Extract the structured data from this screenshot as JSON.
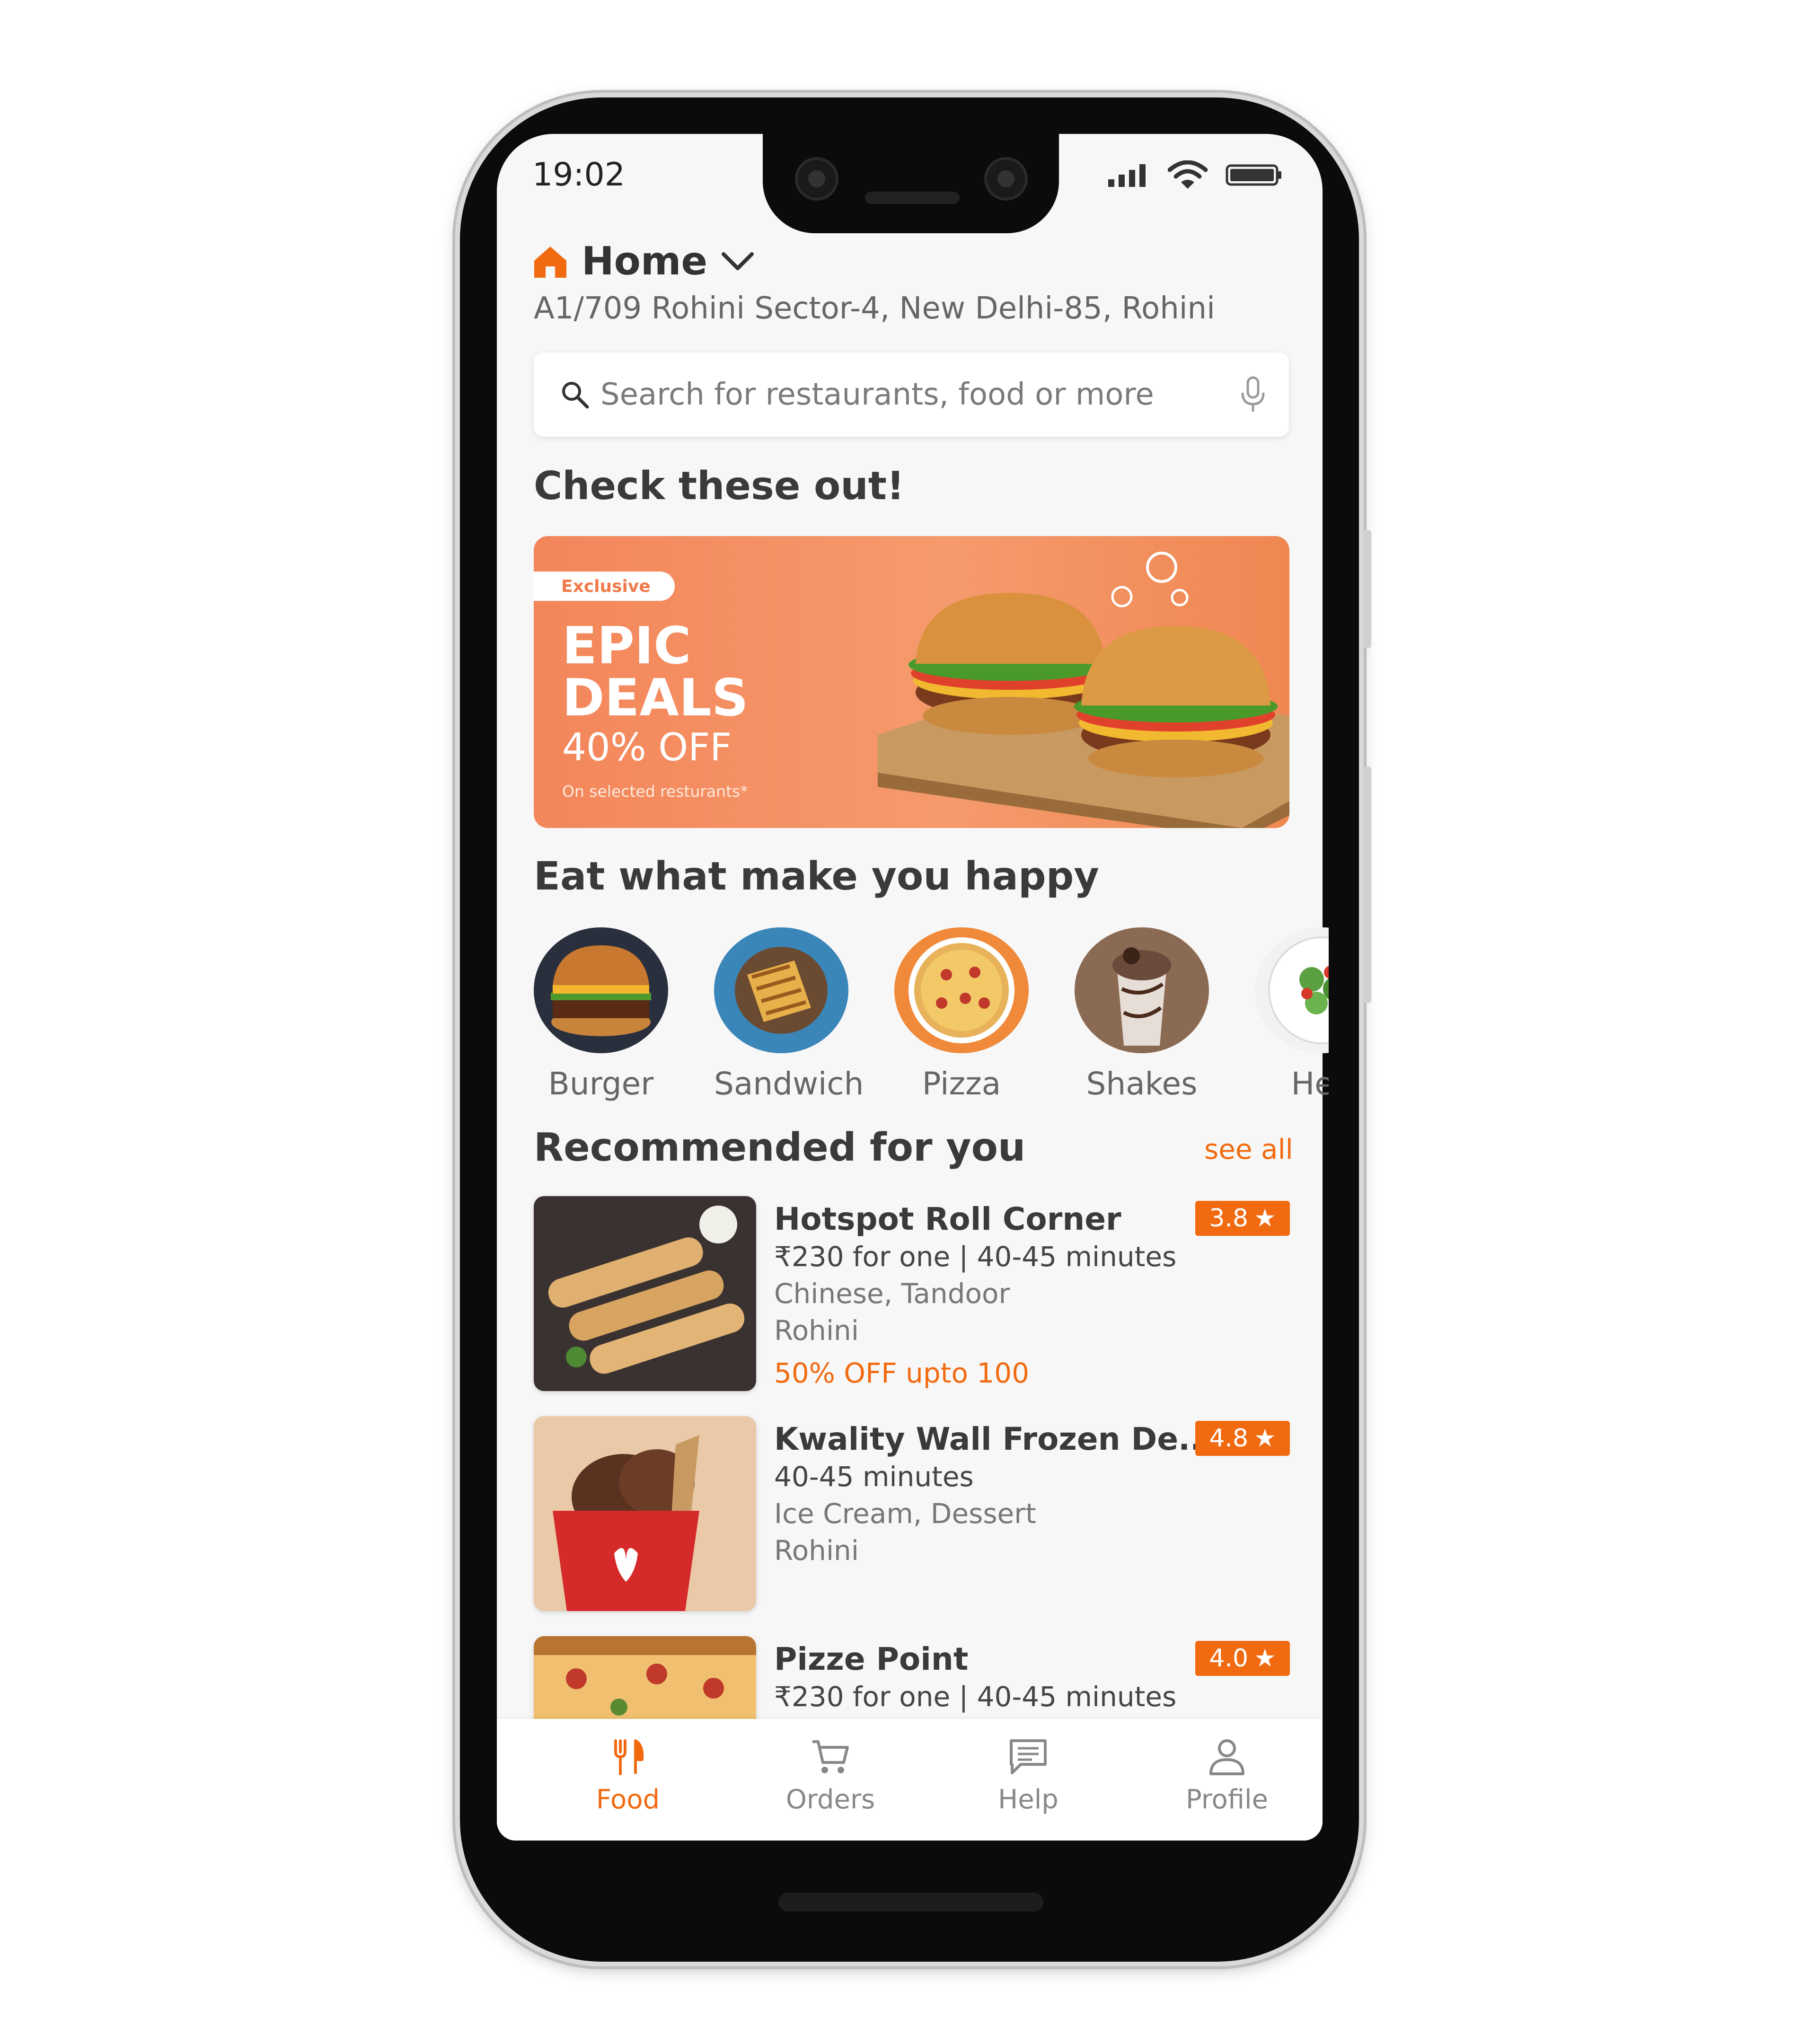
{
  "status": {
    "time": "19:02"
  },
  "location": {
    "label": "Home",
    "address": "A1/709 Rohini Sector-4, New Delhi-85, Rohini"
  },
  "search": {
    "placeholder": "Search for restaurants, food or more"
  },
  "promo": {
    "title": "Check these out!",
    "badge": "Exclusive",
    "headline": "EPIC DEALS",
    "offer": "40% OFF",
    "note": "On selected resturants*"
  },
  "categories": {
    "title": "Eat what make you happy",
    "items": [
      {
        "label": "Burger"
      },
      {
        "label": "Sandwich"
      },
      {
        "label": "Pizza"
      },
      {
        "label": "Shakes"
      },
      {
        "label": "Hea"
      }
    ]
  },
  "recommended": {
    "title": "Recommended for you",
    "see_all": "see all",
    "items": [
      {
        "name": "Hotspot Roll Corner",
        "rating": "3.8",
        "price_time": "₹230 for one | 40-45 minutes",
        "cuisine": "Chinese, Tandoor",
        "area": "Rohini",
        "offer": "50% OFF upto 100"
      },
      {
        "name": "Kwality Wall Frozen De..",
        "rating": "4.8",
        "price_time": "40-45 minutes",
        "cuisine": "Ice Cream, Dessert",
        "area": "Rohini"
      },
      {
        "name": "Pizze Point",
        "rating": "4.0",
        "price_time": "₹230 for one | 40-45 minutes"
      }
    ]
  },
  "nav": {
    "items": [
      {
        "label": "Food",
        "icon": "fork-knife-icon",
        "active": true
      },
      {
        "label": "Orders",
        "icon": "cart-icon"
      },
      {
        "label": "Help",
        "icon": "chat-icon"
      },
      {
        "label": "Profile",
        "icon": "user-icon"
      }
    ]
  },
  "colors": {
    "accent": "#f26a10",
    "banner": "#f3865a",
    "background": "#f7f7f7"
  }
}
